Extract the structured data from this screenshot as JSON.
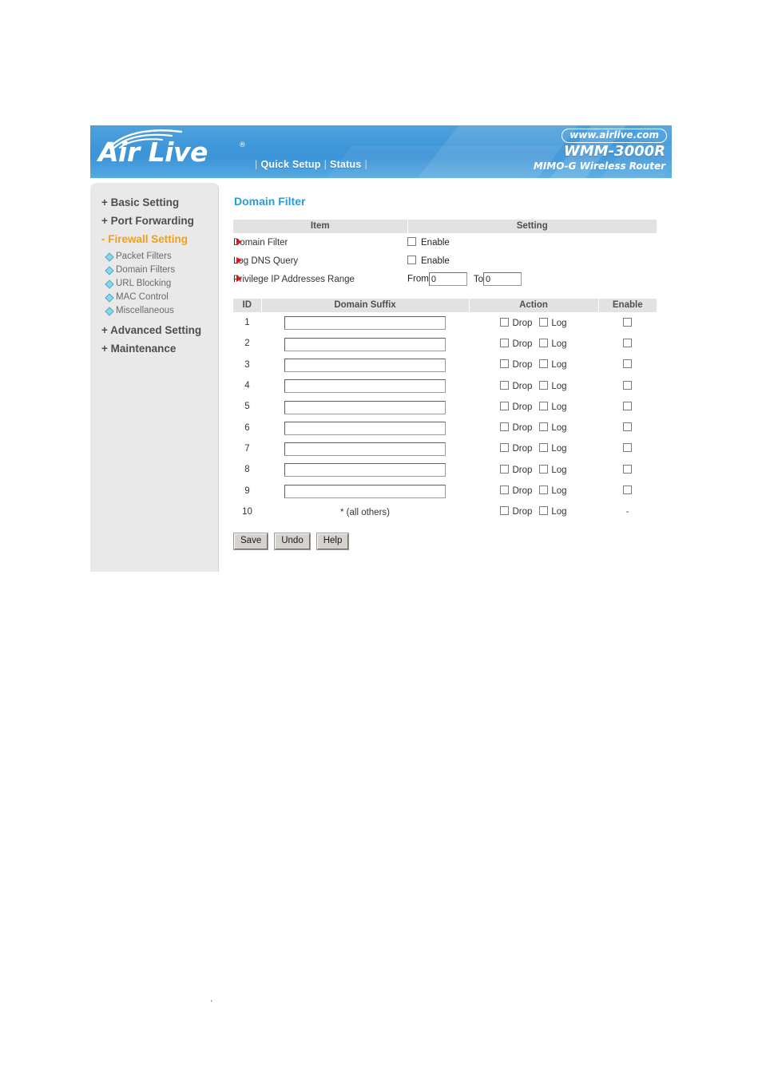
{
  "header": {
    "logo_text": "Air Live",
    "logo_registered": "®",
    "nav_links": [
      "Quick Setup",
      "Status"
    ],
    "website": "www.airlive.com",
    "model": "WMM-3000R",
    "model_subtitle": "MIMO-G Wireless Router",
    "banner_color": "#3f97d8"
  },
  "sidebar": {
    "items": [
      {
        "label": "+ Basic Setting",
        "type": "top",
        "active": false
      },
      {
        "label": "+ Port Forwarding",
        "type": "top",
        "active": false
      },
      {
        "label": "- Firewall Setting",
        "type": "top",
        "active": true
      },
      {
        "label": "Packet Filters",
        "type": "sub"
      },
      {
        "label": "Domain Filters",
        "type": "sub"
      },
      {
        "label": "URL Blocking",
        "type": "sub"
      },
      {
        "label": "MAC Control",
        "type": "sub"
      },
      {
        "label": "Miscellaneous",
        "type": "sub"
      },
      {
        "label": "+ Advanced Setting",
        "type": "top",
        "active": false
      },
      {
        "label": "+ Maintenance",
        "type": "top",
        "active": false
      }
    ],
    "active_color": "#f0a018"
  },
  "main": {
    "page_title": "Domain Filter",
    "settings_table": {
      "headers": [
        "Item",
        "Setting"
      ],
      "rows": [
        {
          "item": "Domain Filter",
          "control": "checkbox",
          "enable_label": "Enable",
          "checked": false
        },
        {
          "item": "Log DNS Query",
          "control": "checkbox",
          "enable_label": "Enable",
          "checked": false
        },
        {
          "item": "Privilege IP Addresses Range",
          "control": "range",
          "from_label": "From",
          "from_value": "0",
          "to_label": "To",
          "to_value": "0"
        }
      ]
    },
    "rules_table": {
      "headers": [
        "ID",
        "Domain Suffix",
        "Action",
        "Enable"
      ],
      "action_labels": {
        "drop": "Drop",
        "log": "Log"
      },
      "rows": [
        {
          "id": "1",
          "suffix": "",
          "is_input": true,
          "drop": false,
          "log": false,
          "enable": false,
          "enable_dash": ""
        },
        {
          "id": "2",
          "suffix": "",
          "is_input": true,
          "drop": false,
          "log": false,
          "enable": false,
          "enable_dash": ""
        },
        {
          "id": "3",
          "suffix": "",
          "is_input": true,
          "drop": false,
          "log": false,
          "enable": false,
          "enable_dash": ""
        },
        {
          "id": "4",
          "suffix": "",
          "is_input": true,
          "drop": false,
          "log": false,
          "enable": false,
          "enable_dash": ""
        },
        {
          "id": "5",
          "suffix": "",
          "is_input": true,
          "drop": false,
          "log": false,
          "enable": false,
          "enable_dash": ""
        },
        {
          "id": "6",
          "suffix": "",
          "is_input": true,
          "drop": false,
          "log": false,
          "enable": false,
          "enable_dash": ""
        },
        {
          "id": "7",
          "suffix": "",
          "is_input": true,
          "drop": false,
          "log": false,
          "enable": false,
          "enable_dash": ""
        },
        {
          "id": "8",
          "suffix": "",
          "is_input": true,
          "drop": false,
          "log": false,
          "enable": false,
          "enable_dash": ""
        },
        {
          "id": "9",
          "suffix": "",
          "is_input": true,
          "drop": false,
          "log": false,
          "enable": false,
          "enable_dash": ""
        },
        {
          "id": "10",
          "suffix": "* (all others)",
          "is_input": false,
          "drop": false,
          "log": false,
          "enable": null,
          "enable_dash": "-"
        }
      ]
    },
    "buttons": [
      {
        "label": "Save"
      },
      {
        "label": "Undo"
      },
      {
        "label": "Help"
      }
    ]
  },
  "artifact": {
    "mark": "'"
  }
}
